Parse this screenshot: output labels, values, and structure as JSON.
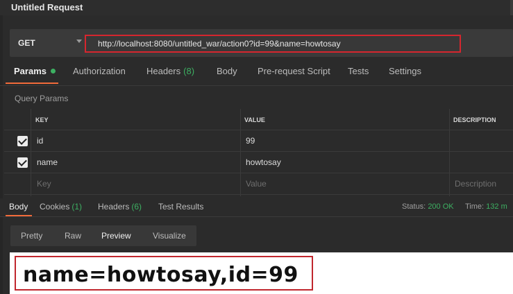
{
  "window": {
    "title": "Untitled Request"
  },
  "request": {
    "method": "GET",
    "url": "http://localhost:8080/untitled_war/action0?id=99&name=howtosay"
  },
  "request_tabs": [
    {
      "label": "Params",
      "active": true,
      "indicator": "green-dot"
    },
    {
      "label": "Authorization"
    },
    {
      "label": "Headers",
      "count": "(8)"
    },
    {
      "label": "Body"
    },
    {
      "label": "Pre-request Script"
    },
    {
      "label": "Tests"
    },
    {
      "label": "Settings"
    }
  ],
  "query_params": {
    "label": "Query Params",
    "columns": [
      "KEY",
      "VALUE",
      "DESCRIPTION"
    ],
    "rows": [
      {
        "checked": true,
        "key": "id",
        "value": "99",
        "description": ""
      },
      {
        "checked": true,
        "key": "name",
        "value": "howtosay",
        "description": ""
      }
    ],
    "placeholder": {
      "key": "Key",
      "value": "Value",
      "description": "Description"
    }
  },
  "response_tabs": [
    {
      "label": "Body",
      "active": true
    },
    {
      "label": "Cookies",
      "count": "(1)"
    },
    {
      "label": "Headers",
      "count": "(6)"
    },
    {
      "label": "Test Results"
    }
  ],
  "response_meta": {
    "status_label": "Status:",
    "status_value": "200 OK",
    "time_label": "Time:",
    "time_value": "132 m"
  },
  "view_tabs": [
    {
      "label": "Pretty"
    },
    {
      "label": "Raw"
    },
    {
      "label": "Preview",
      "active": true
    },
    {
      "label": "Visualize"
    }
  ],
  "response_body": {
    "text": "name=howtosay,id=99"
  },
  "colors": {
    "accent": "#f26b3a",
    "success": "#3db062",
    "highlight_box": "#d6262e"
  }
}
